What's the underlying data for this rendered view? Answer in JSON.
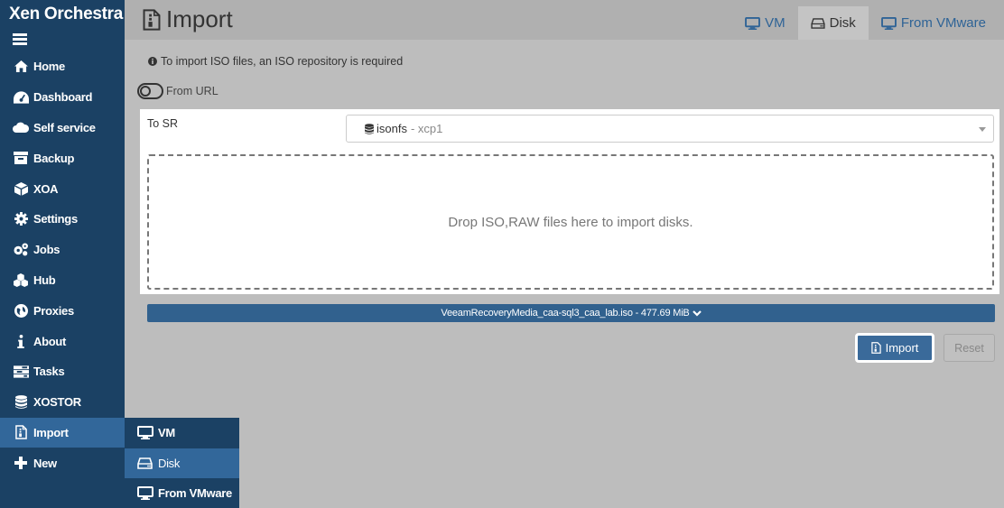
{
  "sidebar": {
    "brand": "Xen Orchestra",
    "items": [
      {
        "label": "Home",
        "icon": "home-icon"
      },
      {
        "label": "Dashboard",
        "icon": "dashboard-icon"
      },
      {
        "label": "Self service",
        "icon": "cloud-icon"
      },
      {
        "label": "Backup",
        "icon": "archive-icon"
      },
      {
        "label": "XOA",
        "icon": "cube-icon"
      },
      {
        "label": "Settings",
        "icon": "gear-icon"
      },
      {
        "label": "Jobs",
        "icon": "gears-icon"
      },
      {
        "label": "Hub",
        "icon": "cubes-icon"
      },
      {
        "label": "Proxies",
        "icon": "globe-icon"
      },
      {
        "label": "About",
        "icon": "info-icon"
      },
      {
        "label": "Tasks",
        "icon": "tasks-icon"
      },
      {
        "label": "XOSTOR",
        "icon": "database-icon"
      },
      {
        "label": "Import",
        "icon": "file-import-icon"
      },
      {
        "label": "New",
        "icon": "plus-icon"
      }
    ]
  },
  "flyout": {
    "items": [
      {
        "label": "VM",
        "icon": "desktop-icon"
      },
      {
        "label": "Disk",
        "icon": "hdd-icon"
      },
      {
        "label": "From VMware",
        "icon": "desktop-icon"
      }
    ]
  },
  "header": {
    "title": "Import",
    "tabs": [
      {
        "label": "VM",
        "icon": "desktop-icon"
      },
      {
        "label": "Disk",
        "icon": "hdd-icon"
      },
      {
        "label": "From VMware",
        "icon": "desktop-icon"
      }
    ]
  },
  "main": {
    "info": "To import ISO files, an ISO repository is required",
    "from_url_label": "From URL",
    "to_sr_label": "To SR",
    "sr_name": "isonfs",
    "sr_host": "- xcp1",
    "dropzone_text": "Drop ISO,RAW files here to import disks.",
    "file_entry": "VeeamRecoveryMedia_caa-sql3_caa_lab.iso - 477.69 MiB",
    "import_button": "Import",
    "reset_button": "Reset"
  },
  "colors": {
    "sidebar_bg": "#1b4164",
    "active_bg": "#32679a",
    "accent": "#2e6396",
    "page_bg": "#bdbdbd"
  }
}
